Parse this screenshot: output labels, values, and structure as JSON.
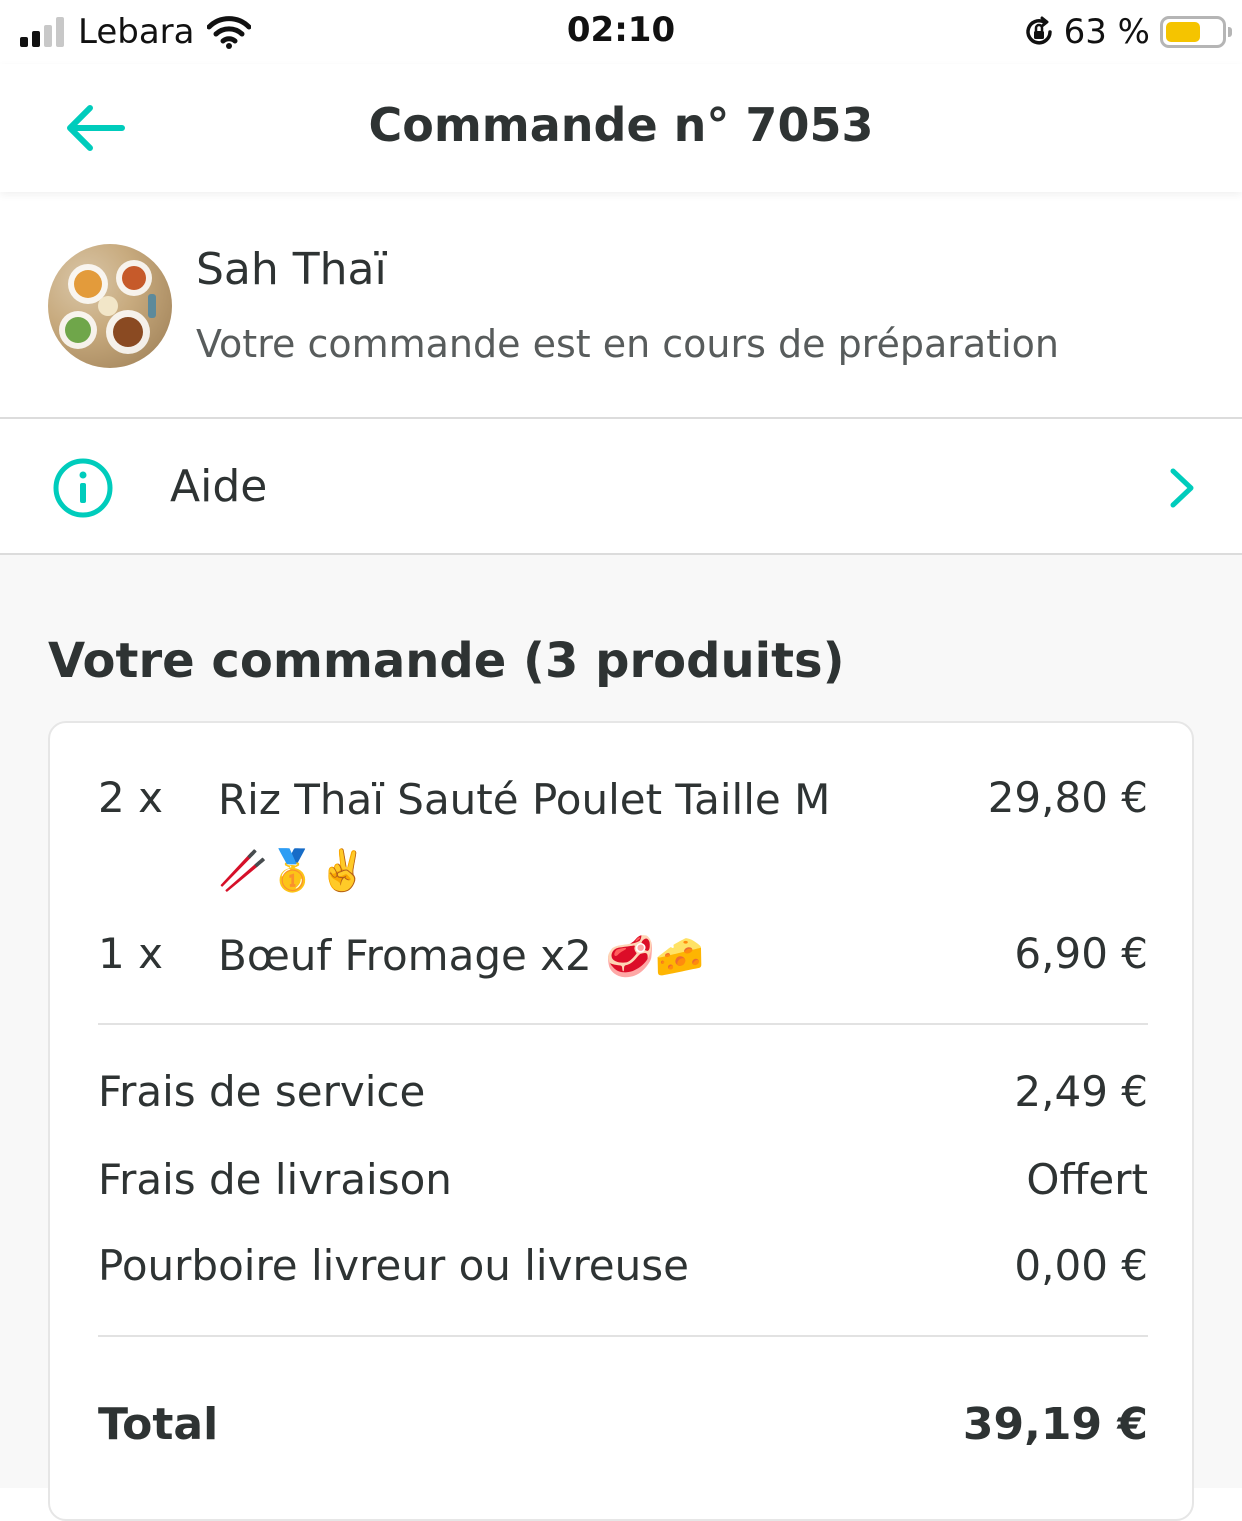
{
  "status_bar": {
    "carrier": "Lebara",
    "time": "02:10",
    "battery_percent": "63 %",
    "battery_level": 0.63
  },
  "nav": {
    "title": "Commande n° 7053"
  },
  "restaurant": {
    "name": "Sah Thaï",
    "status": "Votre commande est en cours de préparation"
  },
  "help": {
    "label": "Aide"
  },
  "order": {
    "heading": "Votre commande (3 produits)",
    "items": [
      {
        "qty": "2 x",
        "name": "Riz Thaï Sauté Poulet Taille M",
        "emojis": "🥢🥇✌️",
        "price": "29,80 €"
      },
      {
        "qty": "1 x",
        "name": "Bœuf Fromage x2",
        "emojis": "🥩🧀",
        "price": "6,90 €"
      }
    ],
    "fees": [
      {
        "label": "Frais de service",
        "value": "2,49 €"
      },
      {
        "label": "Frais de livraison",
        "value": "Offert"
      },
      {
        "label": "Pourboire livreur ou livreuse",
        "value": "0,00 €"
      }
    ],
    "total": {
      "label": "Total",
      "value": "39,19 €"
    }
  },
  "colors": {
    "accent": "#00ccbc",
    "text_primary": "#2e3333",
    "text_secondary": "#585c5c",
    "background": "#f8f8f8",
    "battery": "#f5c400"
  }
}
